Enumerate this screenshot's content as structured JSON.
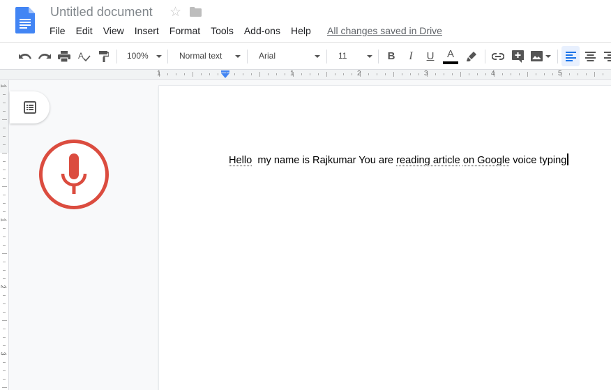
{
  "header": {
    "title": "Untitled document",
    "star_icon": "star-outline-icon",
    "folder_icon": "folder-icon",
    "menu": [
      "File",
      "Edit",
      "View",
      "Insert",
      "Format",
      "Tools",
      "Add-ons",
      "Help"
    ],
    "saved_status": "All changes saved in Drive"
  },
  "toolbar": {
    "undo_icon": "undo-icon",
    "redo_icon": "redo-icon",
    "print_icon": "print-icon",
    "spellcheck_icon": "spellcheck-icon",
    "paint_format_icon": "paint-format-icon",
    "zoom": "100%",
    "style": "Normal text",
    "font": "Arial",
    "font_size": "11",
    "bold": "B",
    "italic": "I",
    "underline": "U",
    "text_color": "A",
    "text_color_value": "#000000",
    "active_alignment": "left"
  },
  "ruler": {
    "labels": [
      "1",
      "1",
      "2",
      "3",
      "4",
      "5"
    ],
    "vertical_labels": [
      "1",
      "1",
      "2",
      "3"
    ]
  },
  "document": {
    "segments": [
      {
        "text": "Hello",
        "spell": true
      },
      {
        "text": "  my name is Rajkumar You are ",
        "spell": false
      },
      {
        "text": "reading article",
        "spell": true
      },
      {
        "text": " ",
        "spell": false
      },
      {
        "text": "on Google",
        "spell": true
      },
      {
        "text": " voice typing",
        "spell": false
      }
    ]
  },
  "voice_typing": {
    "state": "listening",
    "color": "#db4c3f"
  },
  "colors": {
    "accent_blue": "#4285f4",
    "mic_red": "#db4c3f",
    "active_bg": "#e8f0fe"
  }
}
